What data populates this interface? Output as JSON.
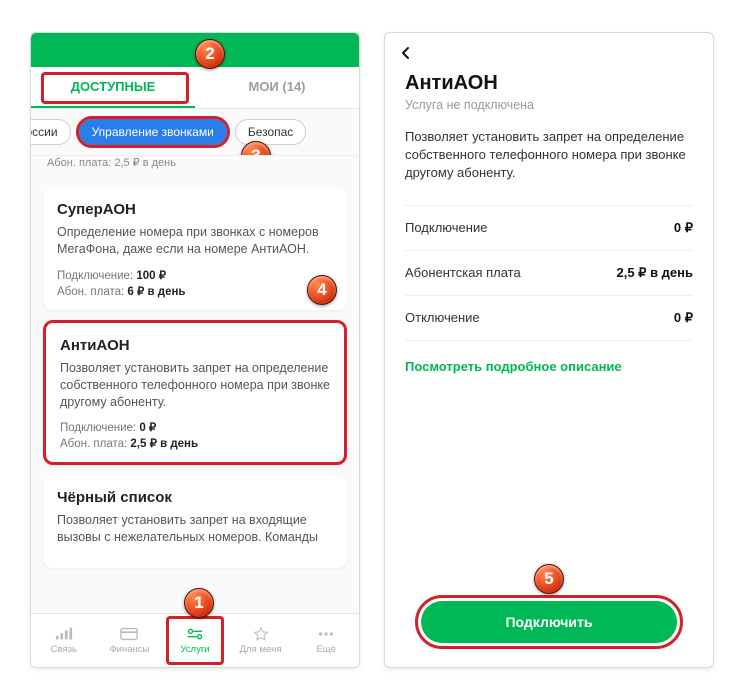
{
  "left": {
    "tabs": {
      "available": "ДОСТУПНЫЕ",
      "mine": "МОИ (14)"
    },
    "chips": {
      "prev": "о России",
      "active": "Управление звонками",
      "next": "Безопас"
    },
    "meta": "Абон. плата: 2,5 ₽ в день",
    "cards": [
      {
        "title": "СуперАОН",
        "desc": "Определение номера при звонках с номеров МегаФона, даже если на номере АнтиАОН.",
        "connect_label": "Подключение:",
        "connect_val": "100 ₽",
        "fee_label": "Абон. плата:",
        "fee_val": "6 ₽ в день"
      },
      {
        "title": "АнтиАОН",
        "desc": "Позволяет установить запрет на определение собственного телефонного номера при звонке другому абоненту.",
        "connect_label": "Подключение:",
        "connect_val": "0 ₽",
        "fee_label": "Абон. плата:",
        "fee_val": "2,5 ₽ в день"
      },
      {
        "title": "Чёрный список",
        "desc": "Позволяет установить запрет на входящие вызовы с нежелательных номеров. Команды"
      }
    ],
    "nav": [
      "Связь",
      "Финансы",
      "Услуги",
      "Для меня",
      "Ещё"
    ]
  },
  "right": {
    "title": "АнтиАОН",
    "sub": "Услуга не подключена",
    "desc": "Позволяет установить запрет на определение собственного телефонного номера при звонке другому абоненту.",
    "rows": [
      {
        "label": "Подключение",
        "val": "0 ₽"
      },
      {
        "label": "Абонентская плата",
        "val": "2,5 ₽ в день"
      },
      {
        "label": "Отключение",
        "val": "0 ₽"
      }
    ],
    "link": "Посмотреть подробное описание",
    "cta": "Подключить"
  },
  "badges": [
    "1",
    "2",
    "3",
    "4",
    "5"
  ]
}
